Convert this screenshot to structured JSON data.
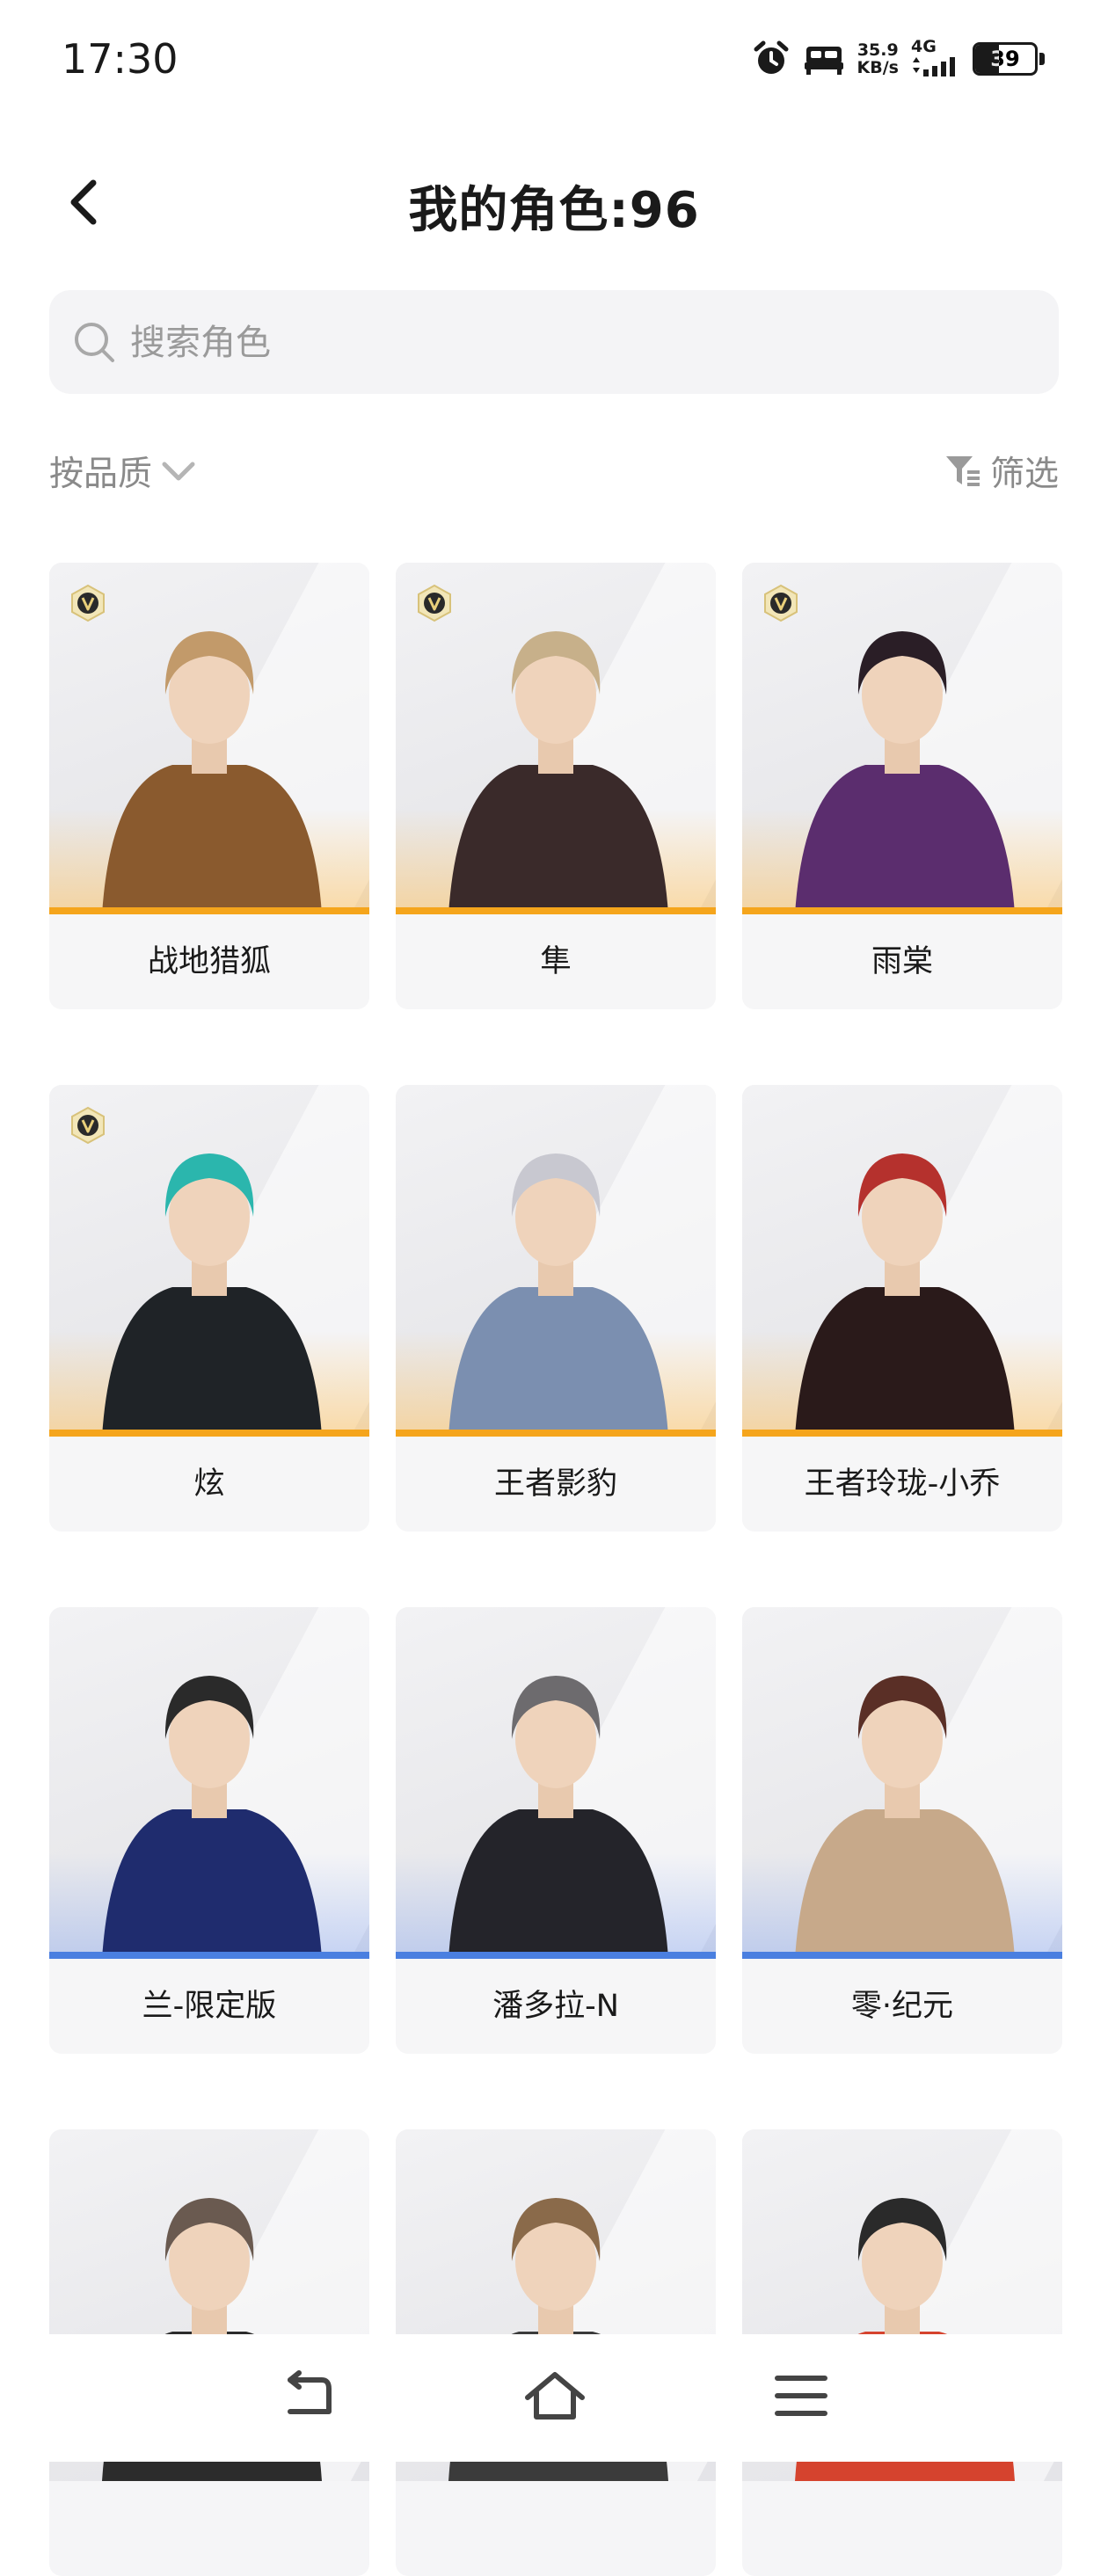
{
  "status_bar": {
    "time": "17:30",
    "icons": [
      "alarm-icon",
      "bed-icon"
    ],
    "speed_value": "35.9",
    "speed_unit": "KB/s",
    "network": "4G",
    "battery": "39",
    "battery_level": 0.39
  },
  "header": {
    "title": "我的角色:96",
    "back_icon": "chevron-left-icon"
  },
  "search": {
    "placeholder": "搜索角色",
    "value": ""
  },
  "toolbar": {
    "sort_label": "按品质",
    "filter_label": "筛选"
  },
  "colors": {
    "gold": "#f5a51c",
    "blue": "#4a7fe0",
    "card_bg": "#f5f5f7"
  },
  "characters": [
    {
      "name": "战地猎狐",
      "tier": "gold",
      "vip": true
    },
    {
      "name": "隼",
      "tier": "gold",
      "vip": true
    },
    {
      "name": "雨棠",
      "tier": "gold",
      "vip": true
    },
    {
      "name": "炫",
      "tier": "gold",
      "vip": true
    },
    {
      "name": "王者影豹",
      "tier": "gold",
      "vip": false
    },
    {
      "name": "王者玲珑-小乔",
      "tier": "gold",
      "vip": false
    },
    {
      "name": "兰-限定版",
      "tier": "blue",
      "vip": false
    },
    {
      "name": "潘多拉-N",
      "tier": "blue",
      "vip": false
    },
    {
      "name": "零·纪元",
      "tier": "blue",
      "vip": false
    },
    {
      "name": "",
      "tier": "none",
      "vip": false
    },
    {
      "name": "",
      "tier": "none",
      "vip": false
    },
    {
      "name": "",
      "tier": "none",
      "vip": false
    }
  ],
  "navbar": {
    "buttons": [
      "back-nav-icon",
      "home-nav-icon",
      "menu-nav-icon"
    ]
  }
}
